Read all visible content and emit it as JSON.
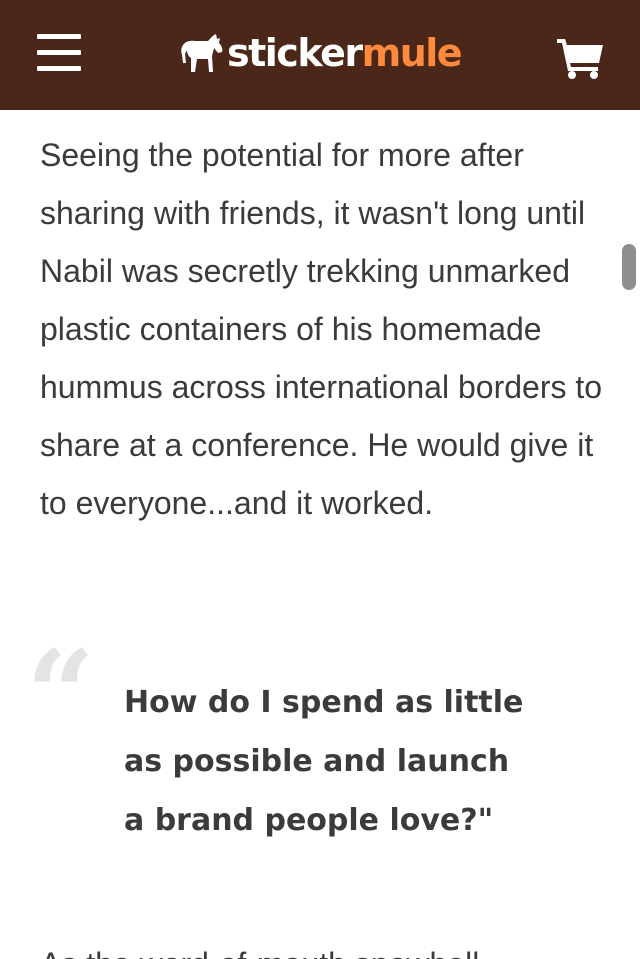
{
  "header": {
    "brand_primary": "sticker",
    "brand_secondary": "mule",
    "background_color": "#4a2718",
    "brand_accent_color": "#ff8a3d",
    "menu_icon": "hamburger-menu-icon",
    "logo_icon": "mule-icon",
    "cart_icon": "shopping-cart-icon"
  },
  "article": {
    "paragraph": "Seeing the potential for more after sharing with friends, it wasn't long until Nabil was secretly trekking unmarked plastic containers of his homemade hummus across international borders to share at a conference. He would give it to everyone...and it worked.",
    "quote_lines": [
      "How do I spend as little",
      "as possible and launch",
      "a brand people love?\""
    ],
    "next_paragraph_start": "As the word-of-mouth snowball"
  }
}
